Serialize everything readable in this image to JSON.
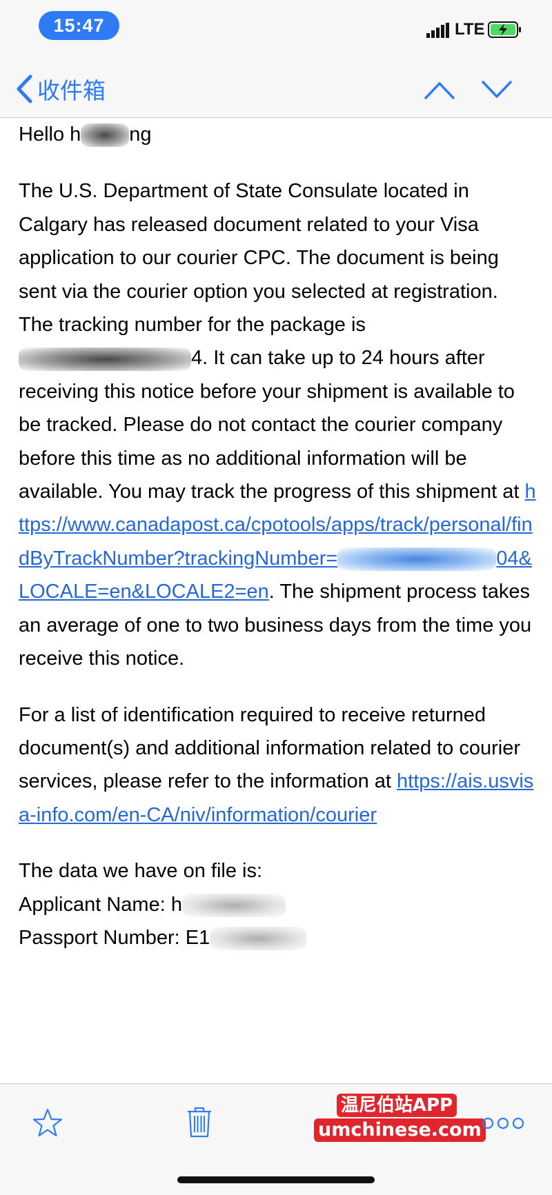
{
  "status_bar": {
    "time": "15:47",
    "network": "LTE",
    "icons": [
      "signal-icon",
      "battery-charging-icon"
    ]
  },
  "nav": {
    "back_label": "收件箱",
    "icons": [
      "chevron-left-icon",
      "chevron-up-icon",
      "chevron-down-icon"
    ]
  },
  "email": {
    "greeting": "Hello h",
    "greeting_tail": "ng",
    "p1": "The U.S. Department of State Consulate located in Calgary has released document related to your Visa application to our courier CPC. The document is being sent via the courier option you selected at registration.",
    "p2_start": "The tracking number for the package is",
    "p2_redacted_tail": "4",
    "p2_rest": ". It can take up to 24 hours after receiving this notice before your shipment is available to be tracked. Please do not contact the courier company before this time as no additional information will be available. You may track the progress of this shipment at",
    "track_link_a": "https://www.canadapost.ca/cpotools/apps/track/personal/findByTrackNumber?trackingNumber=",
    "track_link_b": "04&LOCALE=en&LOCALE2=en",
    "p2_end": ". The shipment process takes an average of one to two business days from the time you receive this notice.",
    "p3_start": "For a list of identification required to receive returned document(s) and additional information related to courier services, please refer to the information at",
    "p3_link": "https://ais.usvisa-info.com/en-CA/niv/information/courier",
    "p4_heading": "The data we have on file is:",
    "applicant_label": "Applicant Name: ",
    "applicant_partial": "h",
    "passport_label": "Passport Number: E1"
  },
  "toolbar": {
    "watermark_line1": "温尼伯站APP",
    "watermark_line2": "umchinese.com",
    "icons": [
      "star-icon",
      "trash-icon",
      "more-icon"
    ]
  },
  "colors": {
    "accent": "#2f7bf5",
    "link": "#2368d5",
    "watermark_bg": "#e0262c"
  }
}
